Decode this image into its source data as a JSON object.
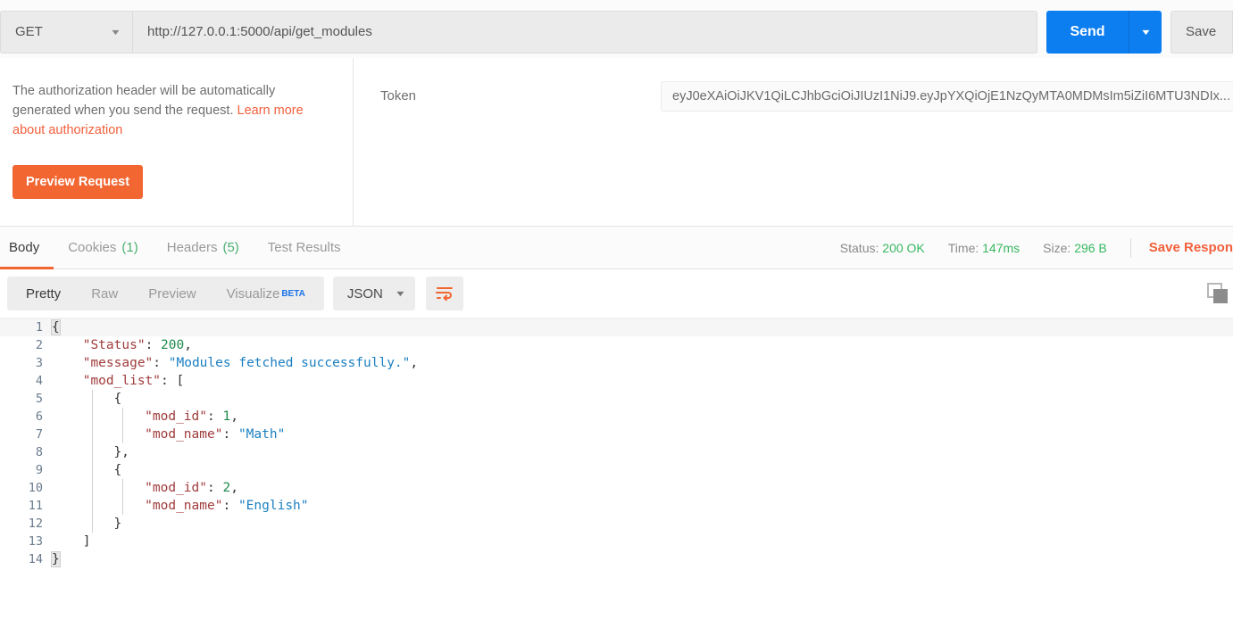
{
  "request": {
    "method": "GET",
    "method_caret": "▼",
    "url": "http://127.0.0.1:5000/api/get_modules",
    "send_label": "Send",
    "send_caret": "▼",
    "save_label": "Save"
  },
  "authorization": {
    "description_part1": "The authorization header will be automatically generated when you send the request. ",
    "link_text": "Learn more about authorization",
    "preview_label": "Preview Request",
    "token_label": "Token",
    "token_value": "eyJ0eXAiOiJKV1QiLCJhbGciOiJIUzI1NiJ9.eyJpYXQiOjE1NzQyMTA0MDMsIm5iZiI6MTU3NDIx..."
  },
  "response": {
    "tabs": [
      {
        "label": "Body",
        "count": "",
        "active": true
      },
      {
        "label": "Cookies",
        "count": "(1)",
        "active": false
      },
      {
        "label": "Headers",
        "count": "(5)",
        "active": false
      },
      {
        "label": "Test Results",
        "count": "",
        "active": false
      }
    ],
    "status_label": "Status:",
    "status_value": "200 OK",
    "time_label": "Time:",
    "time_value": "147ms",
    "size_label": "Size:",
    "size_value": "296 B",
    "save_response_label": "Save Respon",
    "format_tabs": [
      {
        "label": "Pretty",
        "active": true
      },
      {
        "label": "Raw",
        "active": false
      },
      {
        "label": "Preview",
        "active": false
      },
      {
        "label": "Visualize",
        "active": false,
        "badge": "BETA"
      }
    ],
    "language": "JSON",
    "language_caret": "▼",
    "wrap_icon": "wrap-text-icon",
    "copy_icon": "copy-icon"
  },
  "body_json": {
    "Status": 200,
    "message": "Modules fetched successfully.",
    "mod_list": [
      {
        "mod_id": 1,
        "mod_name": "Math"
      },
      {
        "mod_id": 2,
        "mod_name": "English"
      }
    ]
  },
  "body_lines": [
    {
      "num": "1",
      "indent": 0,
      "hl": true,
      "tokens": [
        {
          "t": "{",
          "c": "brk"
        }
      ]
    },
    {
      "num": "2",
      "indent": 1,
      "tokens": [
        {
          "t": "\"Status\"",
          "c": "k"
        },
        {
          "t": ": ",
          "c": "p"
        },
        {
          "t": "200",
          "c": "n"
        },
        {
          "t": ",",
          "c": "p"
        }
      ]
    },
    {
      "num": "3",
      "indent": 1,
      "tokens": [
        {
          "t": "\"message\"",
          "c": "k"
        },
        {
          "t": ": ",
          "c": "p"
        },
        {
          "t": "\"Modules fetched successfully.\"",
          "c": "s"
        },
        {
          "t": ",",
          "c": "p"
        }
      ]
    },
    {
      "num": "4",
      "indent": 1,
      "tokens": [
        {
          "t": "\"mod_list\"",
          "c": "k"
        },
        {
          "t": ": [",
          "c": "p"
        }
      ]
    },
    {
      "num": "5",
      "indent": 2,
      "tokens": [
        {
          "t": "{",
          "c": "p"
        }
      ]
    },
    {
      "num": "6",
      "indent": 3,
      "tokens": [
        {
          "t": "\"mod_id\"",
          "c": "k"
        },
        {
          "t": ": ",
          "c": "p"
        },
        {
          "t": "1",
          "c": "n"
        },
        {
          "t": ",",
          "c": "p"
        }
      ]
    },
    {
      "num": "7",
      "indent": 3,
      "tokens": [
        {
          "t": "\"mod_name\"",
          "c": "k"
        },
        {
          "t": ": ",
          "c": "p"
        },
        {
          "t": "\"Math\"",
          "c": "s"
        }
      ]
    },
    {
      "num": "8",
      "indent": 2,
      "tokens": [
        {
          "t": "},",
          "c": "p"
        }
      ]
    },
    {
      "num": "9",
      "indent": 2,
      "tokens": [
        {
          "t": "{",
          "c": "p"
        }
      ]
    },
    {
      "num": "10",
      "indent": 3,
      "tokens": [
        {
          "t": "\"mod_id\"",
          "c": "k"
        },
        {
          "t": ": ",
          "c": "p"
        },
        {
          "t": "2",
          "c": "n"
        },
        {
          "t": ",",
          "c": "p"
        }
      ]
    },
    {
      "num": "11",
      "indent": 3,
      "tokens": [
        {
          "t": "\"mod_name\"",
          "c": "k"
        },
        {
          "t": ": ",
          "c": "p"
        },
        {
          "t": "\"English\"",
          "c": "s"
        }
      ]
    },
    {
      "num": "12",
      "indent": 2,
      "tokens": [
        {
          "t": "}",
          "c": "p"
        }
      ]
    },
    {
      "num": "13",
      "indent": 1,
      "tokens": [
        {
          "t": "]",
          "c": "p"
        }
      ]
    },
    {
      "num": "14",
      "indent": 0,
      "tokens": [
        {
          "t": "}",
          "c": "brk"
        }
      ]
    }
  ],
  "colors": {
    "accent_orange": "#f26632",
    "send_blue": "#0d7ef0",
    "status_green": "#38b861",
    "beta_blue": "#1a73e8"
  }
}
